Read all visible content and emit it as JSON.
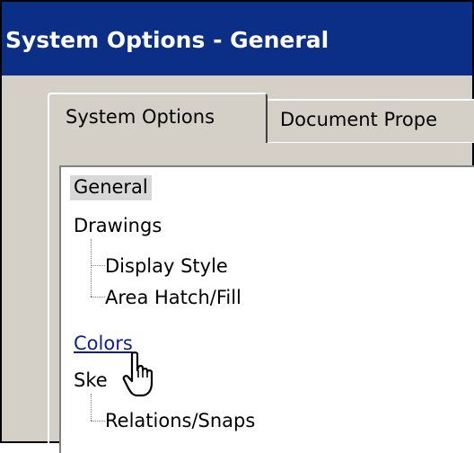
{
  "window": {
    "title": "System Options - General"
  },
  "tabs": [
    {
      "label": "System Options",
      "active": true
    },
    {
      "label": "Document Prope",
      "active": false
    }
  ],
  "tree": {
    "items": [
      {
        "label": "General",
        "selected": true,
        "level": 0
      },
      {
        "label": "Drawings",
        "level": 0
      },
      {
        "label": "Display Style",
        "level": 1
      },
      {
        "label": "Area Hatch/Fill",
        "level": 1
      },
      {
        "label": "Colors",
        "level": 0,
        "hovered": true
      },
      {
        "label": "Ske",
        "level": 0
      },
      {
        "label": "Relations/Snaps",
        "level": 1
      }
    ]
  },
  "cursor": {
    "icon": "hand-pointer-icon"
  },
  "colors": {
    "titlebar": "#0b2f86",
    "dialog_face": "#d4d0c8",
    "link": "#0b1f9e"
  }
}
